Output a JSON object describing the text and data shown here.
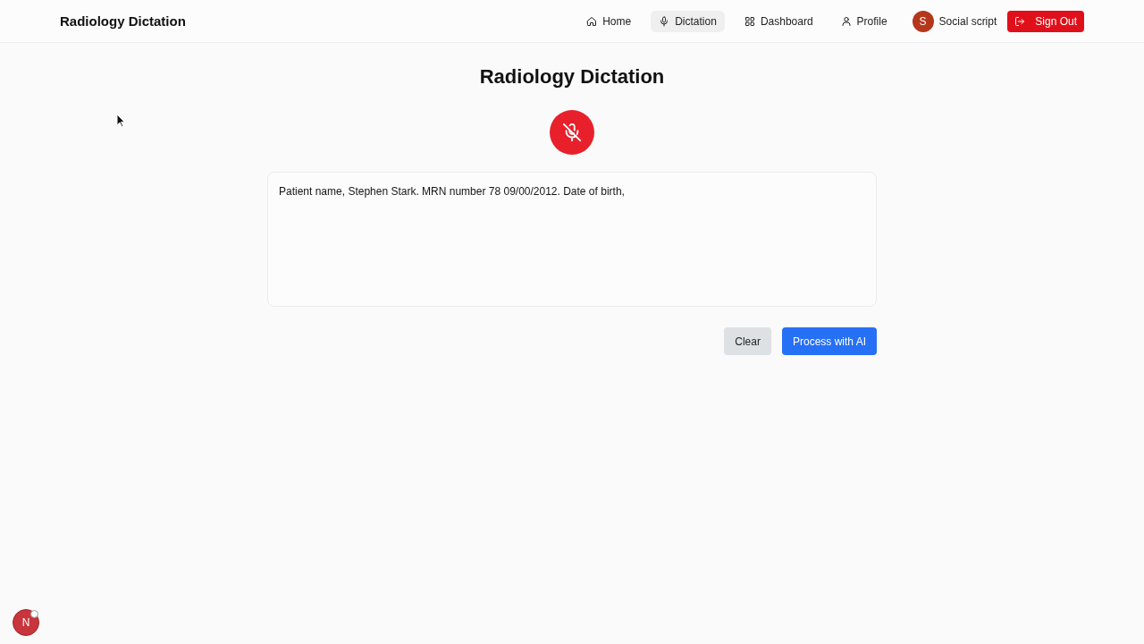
{
  "header": {
    "brand": "Radiology Dictation",
    "nav": [
      {
        "label": "Home",
        "selected": false
      },
      {
        "label": "Dictation",
        "selected": true
      },
      {
        "label": "Dashboard",
        "selected": false
      },
      {
        "label": "Profile",
        "selected": false
      }
    ],
    "user": {
      "avatar_initial": "S",
      "name": "Social script"
    },
    "sign_out": "Sign Out"
  },
  "page": {
    "title": "Radiology Dictation",
    "mic_button": {
      "recording": true
    },
    "transcript": {
      "value": "Patient name, Stephen Stark. MRN number 78 09/00/2012. Date of birth,"
    },
    "actions": [
      {
        "label": "Clear",
        "kind": "secondary"
      },
      {
        "label": "Process with AI",
        "kind": "primary"
      }
    ]
  },
  "dev_badge": {
    "label": "N"
  }
}
